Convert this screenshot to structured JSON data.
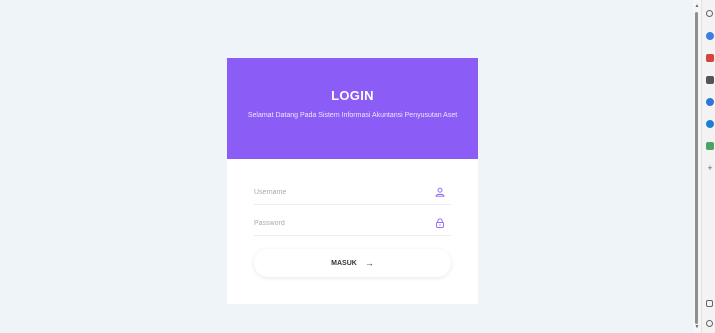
{
  "login": {
    "title": "LOGIN",
    "subtitle": "Selamat Datang Pada Sistem Informasi Akuntansi Penyusutan Aset",
    "username_placeholder": "Username",
    "password_placeholder": "Password",
    "submit_label": "MASUK",
    "submit_arrow": "→"
  },
  "colors": {
    "header": "#8c5cf7",
    "icon": "#8c5cf7",
    "background": "#eff4f8"
  },
  "icons": {
    "username": "user-icon",
    "password": "lock-icon",
    "submit": "arrow-right-icon"
  }
}
